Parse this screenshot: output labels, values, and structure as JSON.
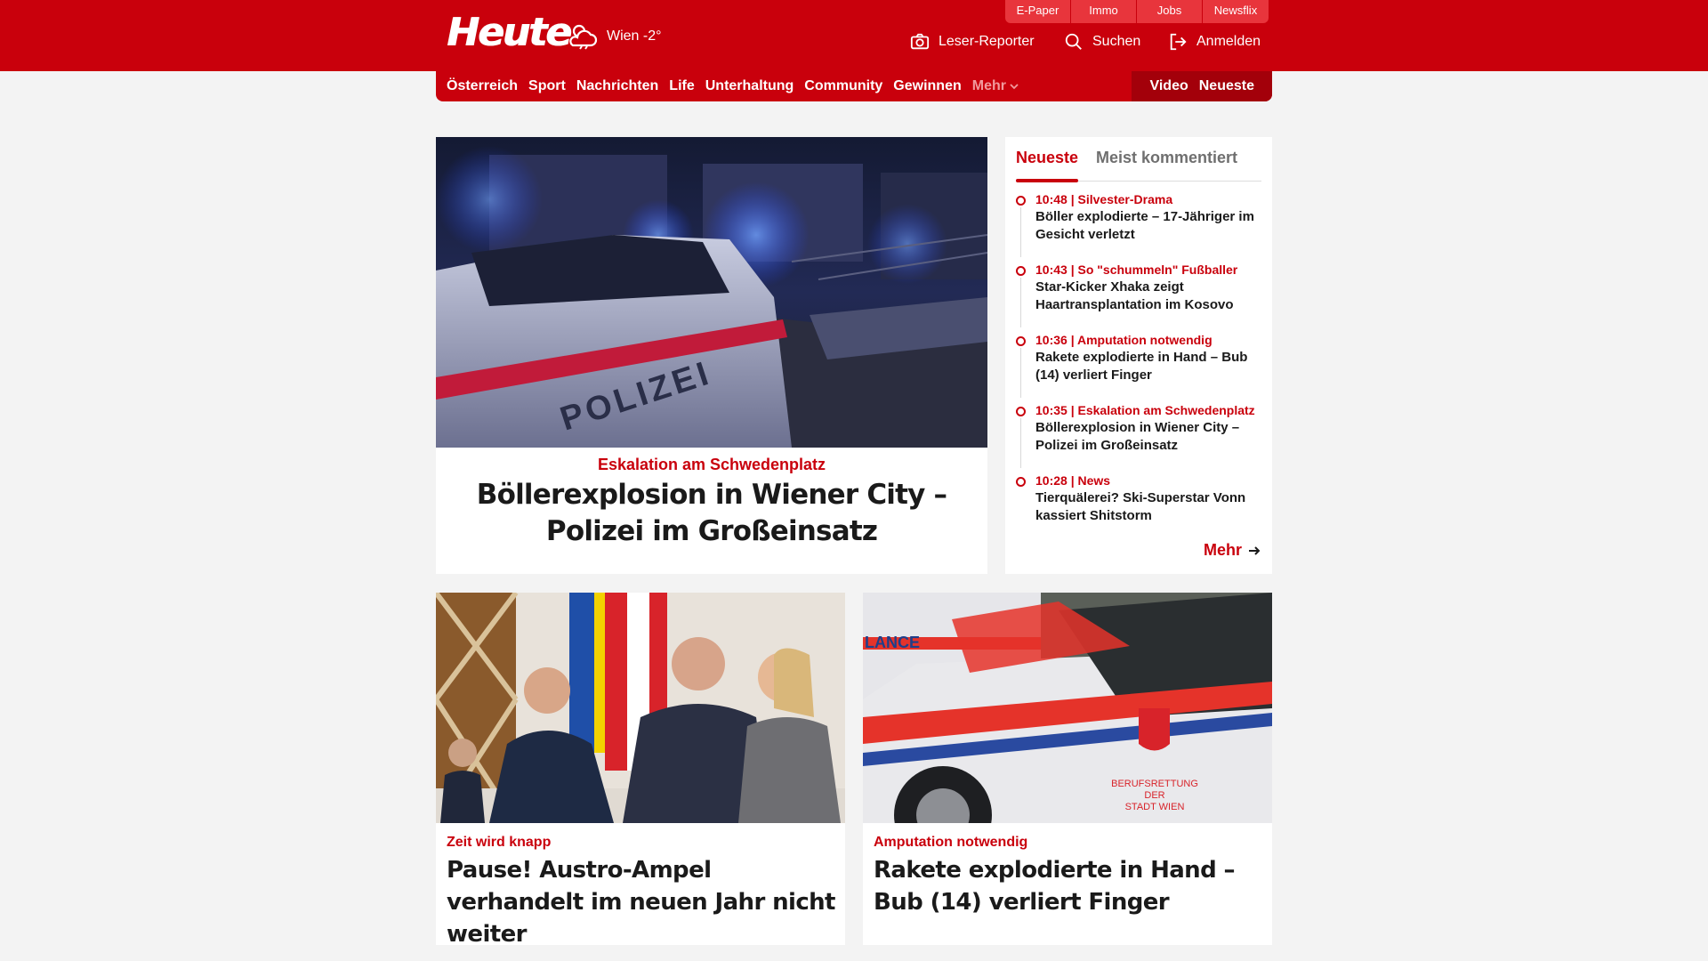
{
  "brand": {
    "logo": "Heute",
    "weather": "Wien -2°"
  },
  "utility_links": [
    "E-Paper",
    "Immo",
    "Jobs",
    "Newsflix"
  ],
  "actions": {
    "reporter": "Leser-Reporter",
    "search": "Suchen",
    "login": "Anmelden"
  },
  "nav": {
    "items": [
      "Österreich",
      "Sport",
      "Nachrichten",
      "Life",
      "Unterhaltung",
      "Community",
      "Gewinnen"
    ],
    "more": "Mehr",
    "right": [
      "Video",
      "Neueste"
    ]
  },
  "hero": {
    "kicker": "Eskalation am Schwedenplatz",
    "title": "Böllerexplosion in Wiener City – Polizei im Großeinsatz",
    "image_text": "POLIZEI"
  },
  "sidebar": {
    "tabs": [
      "Neueste",
      "Meist kommentiert"
    ],
    "items": [
      {
        "meta": "10:48 | Silvester-Drama",
        "title": "Böller explodierte – 17-Jähriger im Gesicht verletzt"
      },
      {
        "meta": "10:43 | So \"schummeln\" Fußballer",
        "title": "Star-Kicker Xhaka zeigt Haartransplantation im Kosovo"
      },
      {
        "meta": "10:36 | Amputation notwendig",
        "title": "Rakete explodierte in Hand – Bub (14) verliert Finger"
      },
      {
        "meta": "10:35 | Eskalation am Schwedenplatz",
        "title": "Böllerexplosion in Wiener City – Polizei im Großeinsatz"
      },
      {
        "meta": "10:28 | News",
        "title": "Tierquälerei? Ski-Superstar Vonn kassiert Shitstorm"
      }
    ],
    "more": "Mehr"
  },
  "cards": [
    {
      "kicker": "Zeit wird knapp",
      "title": "Pause! Austro-Ampel verhandelt im neuen Jahr nicht weiter"
    },
    {
      "kicker": "Amputation notwendig",
      "title": "Rakete explodierte in Hand – Bub (14) verliert Finger",
      "image_text": [
        "BERUFSRETTUNG",
        "DER",
        "STADT WIEN",
        "LANCE"
      ]
    }
  ],
  "colors": {
    "brand_red": "#c9000c",
    "dark_red": "#a3000a",
    "background": "#f3f3f3"
  }
}
